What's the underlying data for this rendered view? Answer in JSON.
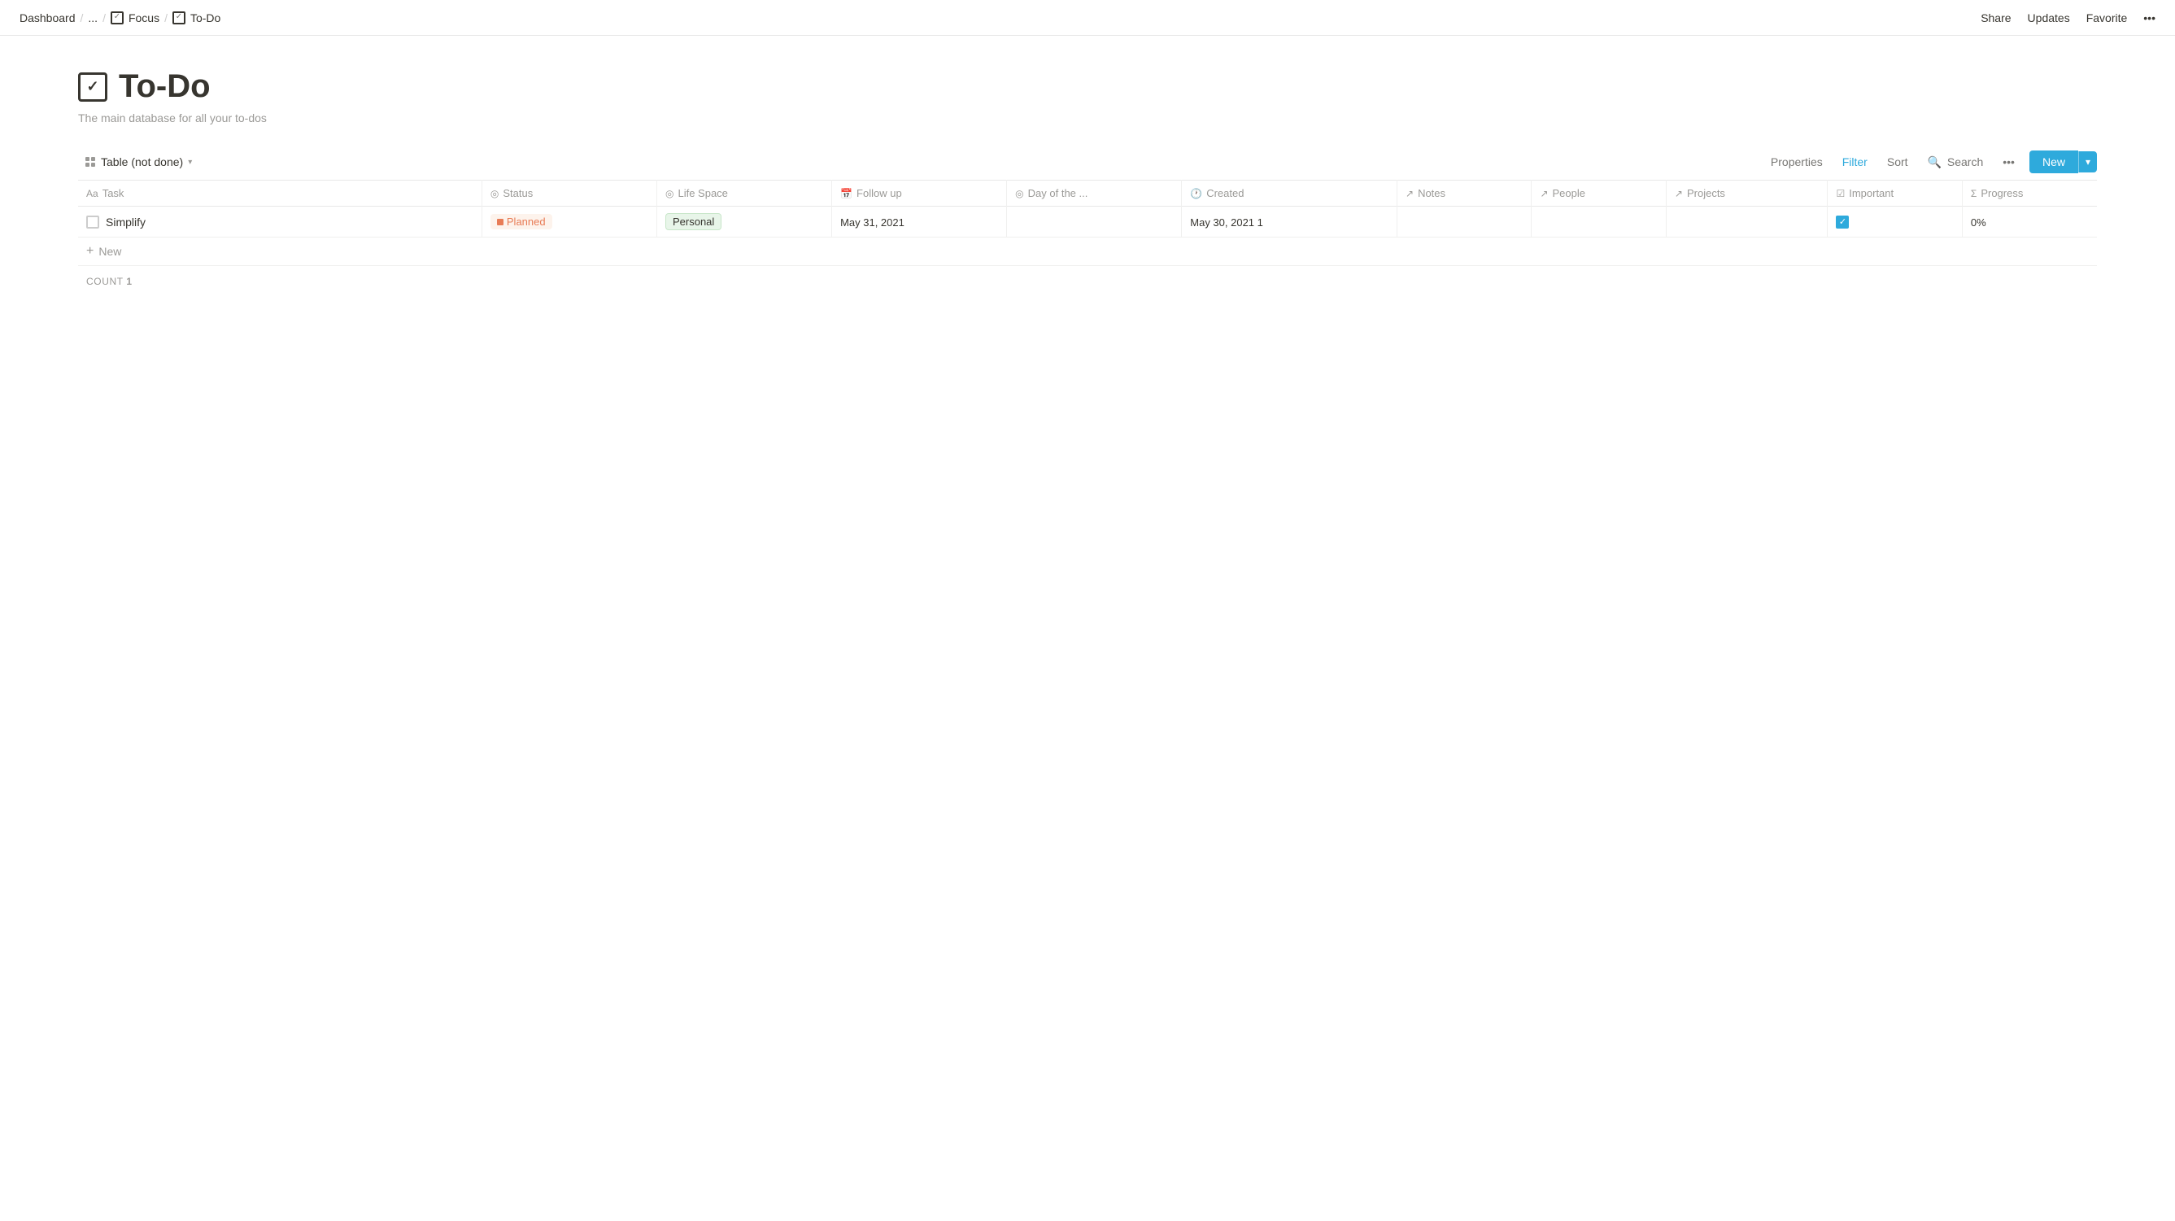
{
  "nav": {
    "breadcrumb": [
      {
        "label": "Dashboard",
        "icon": false
      },
      {
        "label": "...",
        "icon": false
      },
      {
        "label": "Focus",
        "icon": "checkbox"
      },
      {
        "label": "To-Do",
        "icon": "checkbox"
      }
    ],
    "actions": [
      "Share",
      "Updates",
      "Favorite",
      "•••"
    ]
  },
  "page": {
    "title": "To-Do",
    "description": "The main database for all your to-dos"
  },
  "toolbar": {
    "view_label": "Table (not done)",
    "properties_label": "Properties",
    "filter_label": "Filter",
    "sort_label": "Sort",
    "search_label": "Search",
    "more_label": "•••",
    "new_label": "New"
  },
  "table": {
    "columns": [
      {
        "key": "task",
        "label": "Task",
        "icon": "text-icon"
      },
      {
        "key": "status",
        "label": "Status",
        "icon": "circle-icon"
      },
      {
        "key": "lifespace",
        "label": "Life Space",
        "icon": "circle-icon"
      },
      {
        "key": "followup",
        "label": "Follow up",
        "icon": "calendar-icon"
      },
      {
        "key": "dayof",
        "label": "Day of the ...",
        "icon": "circle-icon"
      },
      {
        "key": "created",
        "label": "Created",
        "icon": "clock-icon"
      },
      {
        "key": "notes",
        "label": "Notes",
        "icon": "arrow-icon"
      },
      {
        "key": "people",
        "label": "People",
        "icon": "arrow-icon"
      },
      {
        "key": "projects",
        "label": "Projects",
        "icon": "arrow-icon"
      },
      {
        "key": "important",
        "label": "Important",
        "icon": "check-icon"
      },
      {
        "key": "progress",
        "label": "Progress",
        "icon": "sigma-icon"
      }
    ],
    "rows": [
      {
        "task": "Simplify",
        "status": "Planned",
        "lifespace": "Personal",
        "followup": "May 31, 2021",
        "dayof": "",
        "created": "May 30, 2021 1",
        "notes": "",
        "people": "",
        "projects": "",
        "important": true,
        "progress": "0%"
      }
    ],
    "new_row_label": "New",
    "count_label": "COUNT",
    "count_value": "1"
  }
}
